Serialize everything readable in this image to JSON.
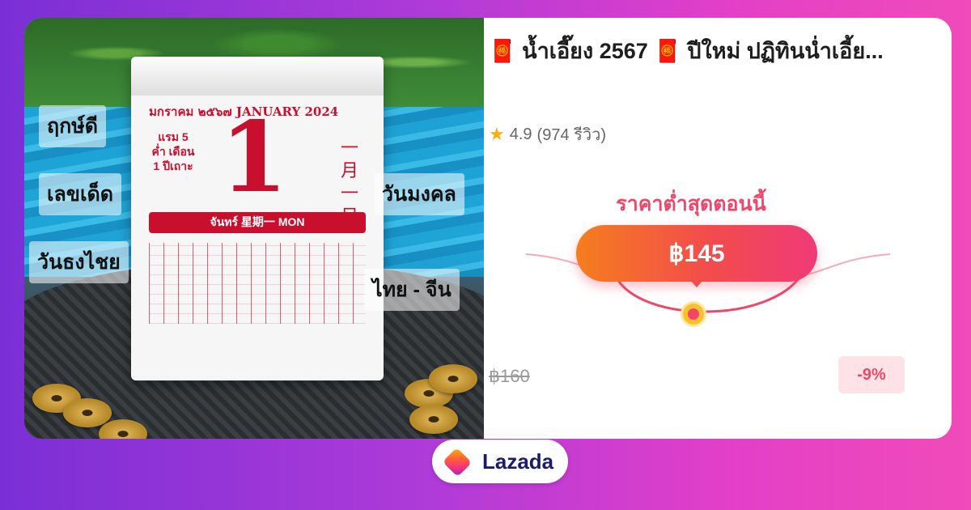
{
  "product": {
    "title": "🧧 น้ำเอี๊ยง 2567 🧧 ปีใหม่ ปฏิทินน่ำเอี้ย...",
    "rating": "4.9",
    "reviews": "(974 รีวิว)",
    "lowest_price_label": "ราคาต่ำสุดตอนนี้",
    "price": "฿145",
    "original_price": "฿160",
    "discount": "-9%"
  },
  "image_labels": {
    "left_1": "ฤกษ์ดี",
    "left_2": "เลขเด็ด",
    "left_3": "วันธงไชย",
    "right_1": "วันมงคล",
    "right_2": "ไทย - จีน"
  },
  "calendar": {
    "month_line": "มกราคม ๒๕๖๗ JANUARY 2024",
    "day": "1",
    "side_text": "แรม 5 ค่ำ เดือน 1 ปีเถาะ",
    "chinese_date": "一月一日",
    "weekday_band": "จันทร์ 星期一 MON"
  },
  "brand": {
    "name": "Lazada"
  },
  "colors": {
    "accent_pink": "#f0466a",
    "price_gradient_start": "#f57d1f",
    "price_gradient_end": "#ef3a78",
    "star": "#faad14",
    "background_start": "#7a2fd6",
    "background_end": "#f04bb9"
  },
  "icons": [
    "star-icon",
    "lazada-heart-icon",
    "price-dot-icon"
  ]
}
